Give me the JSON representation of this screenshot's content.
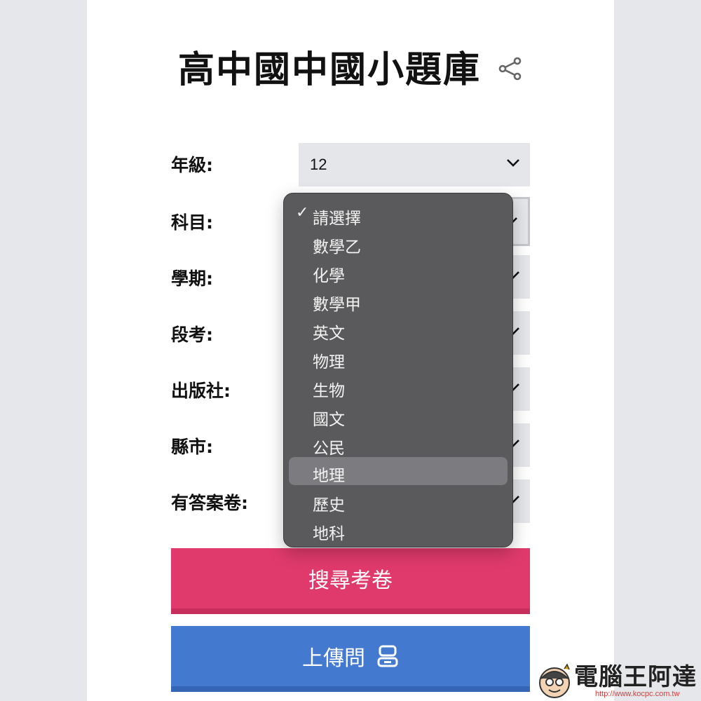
{
  "title": "高中國中國小題庫",
  "form": {
    "fields": [
      {
        "label": "年級:",
        "value": "12"
      },
      {
        "label": "科目:",
        "value": ""
      },
      {
        "label": "學期:",
        "value": ""
      },
      {
        "label": "段考:",
        "value": ""
      },
      {
        "label": "出版社:",
        "value": ""
      },
      {
        "label": "縣市:",
        "value": ""
      },
      {
        "label": "有答案卷:",
        "value": ""
      }
    ]
  },
  "dropdown": {
    "selected": "請選擇",
    "hovered": "地理",
    "options": [
      "請選擇",
      "數學乙",
      "化學",
      "數學甲",
      "英文",
      "物理",
      "生物",
      "國文",
      "公民",
      "地理",
      "歷史",
      "地科"
    ],
    "check_mark": "✓"
  },
  "buttons": {
    "search_label": "搜尋考卷",
    "upload_label": "上傳問"
  },
  "watermark": {
    "title": "電腦王阿達",
    "url": "http://www.kocpc.com.tw"
  },
  "colors": {
    "search_button": "#e03a6c",
    "upload_button": "#4379cf",
    "select_bg": "#e4e6ea",
    "dropdown_bg": "#5a5a5c",
    "hover_bg": "#7c7c80"
  },
  "icons": {
    "share": "share-icon",
    "chevron": "chevron-down-icon",
    "robot": "robot-icon",
    "check": "checkmark-icon"
  }
}
